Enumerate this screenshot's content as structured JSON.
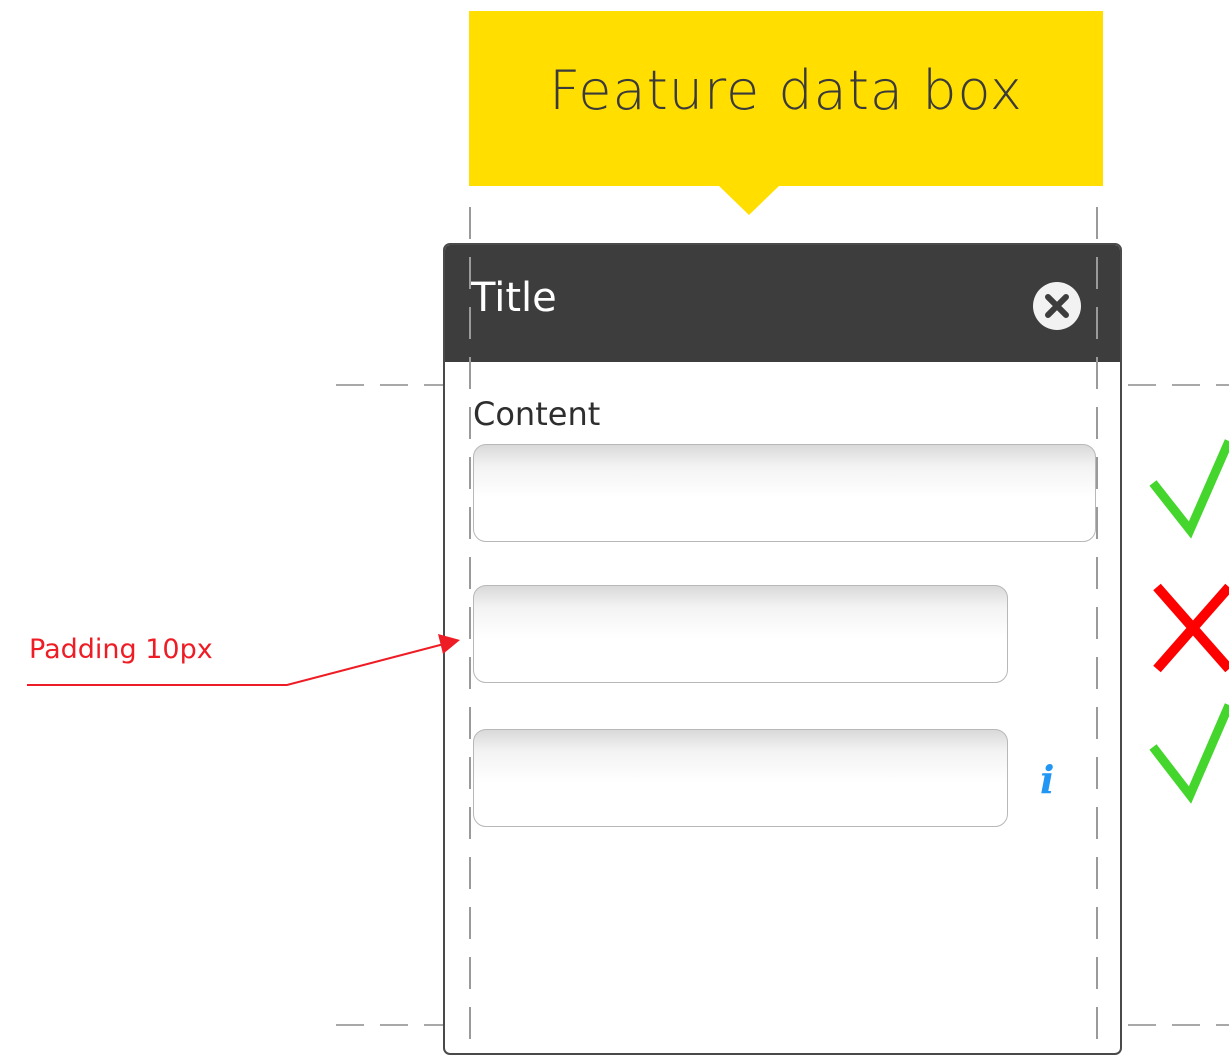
{
  "callout": {
    "text": "Feature data box",
    "color": "#ffde00"
  },
  "panel": {
    "header_color": "#3d3d3d",
    "title": "Title",
    "close_icon": "close-circle-icon",
    "content_label": "Content",
    "info_icon": "info-icon",
    "info_glyph": "i",
    "info_color": "#2196f3"
  },
  "annotation": {
    "text": "Padding 10px",
    "color": "#ee1c24"
  },
  "verdicts": [
    {
      "icon": "check-icon",
      "status": "correct",
      "color": "#44d62c"
    },
    {
      "icon": "cross-icon",
      "status": "incorrect",
      "color": "#ff0000"
    },
    {
      "icon": "check-icon",
      "status": "correct",
      "color": "#44d62c"
    }
  ]
}
